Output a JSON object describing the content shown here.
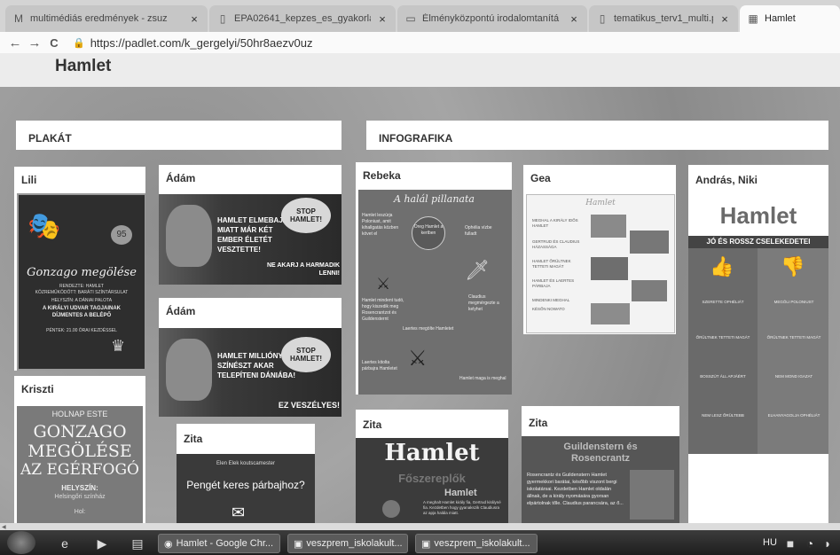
{
  "browser": {
    "tabs": [
      {
        "title": "multimédiás eredmények - zsuz",
        "icon": "gmail-icon",
        "glyph": "M"
      },
      {
        "title": "EPA02641_kepzes_es_gyakorlat",
        "icon": "document-icon",
        "glyph": "▯"
      },
      {
        "title": "Élményközpontú irodalomtanítá",
        "icon": "book-icon",
        "glyph": "▭"
      },
      {
        "title": "tematikus_terv1_multi.pdf",
        "icon": "document-icon",
        "glyph": "▯"
      },
      {
        "title": "Hamlet",
        "icon": "padlet-icon",
        "glyph": "▦"
      }
    ],
    "url": "https://padlet.com/k_gergelyi/50hr8aezv0uz",
    "back": "←",
    "forward": "→",
    "reload": "C",
    "close": "×"
  },
  "padlet": {
    "title": "Hamlet",
    "sections": [
      {
        "title": "PLAKÁT"
      },
      {
        "title": "INFOGRAFIKA"
      }
    ],
    "cards": {
      "lili": {
        "author": "Lili",
        "poster_title": "Gonzago megölése",
        "poster_sub1": "RENDEZTE: HAMLET",
        "poster_sub2": "KÖZREMŰKÖDŐTT: BARÁTI SZÍNTÁRSULAT",
        "poster_sub3": "HELYSZÍN: A DÁNIAI PALOTA",
        "poster_sub4": "A KIRÁLYI UDVAR TAGJAINAK DÍJMENTES A BELÉPŐ",
        "poster_sub5": "PÉNTEK: 21.00 ÓRAI KEZDÉSSEL",
        "mask_text": "95"
      },
      "adam1": {
        "author": "Ádám",
        "text": "HAMLET ELMEBAJA MIATT MÁR KÉT EMBER ÉLETÉT VESZTETTE!",
        "text2": "NE AKARJ A HARMADIK LENNI!",
        "sign": "STOP HAMLET!"
      },
      "adam2": {
        "author": "Ádám",
        "text": "HAMLET MILLIÓNYI SZÍNÉSZT AKAR TELEPÍTENI DÁNIÁBA!",
        "text2": "EZ VESZÉLYES!",
        "sign": "STOP HAMLET!"
      },
      "kriszti": {
        "author": "Kriszti",
        "line1": "HOLNAP ESTE",
        "line2": "GONZAGO",
        "line3": "MEGÖLÉSE",
        "line4": "AZ EGÉRFOGÓ",
        "line5": "HELYSZÍN:",
        "line6": "Helsingőri színház",
        "line7": "Hol:"
      },
      "zita1": {
        "author": "Zita",
        "small": "Elen Elek koutscamester",
        "headline": "Pengét keres párbajhoz?"
      },
      "rebeka": {
        "author": "Rebeka",
        "heading": "A halál pillanata",
        "t1": "Hamlet leszúrja Poloniust, amit kihallgatás közben követ el",
        "t2": "Oreg Hamlet a kertben",
        "t3": "Ophélia vízbe fulladt",
        "t4": "Hamlet mindent tudó, hogy kiszedik meg Rosencrantzot és Guildensternt",
        "t5": "Claudius megmérgezte a kelyhet",
        "t6": "Laertes megölte Hamletet",
        "t7": "Laertes kitolta párbajra Hamletet",
        "t8": "Hamlet maga is meghal"
      },
      "gea": {
        "author": "Gea",
        "heading": "Hamlet",
        "b1": "MEGHAL A KIRÁLY IDŐS HAMLET",
        "b2": "GERTRUD ÉS CLAUDIUS HÁZASSÁGA",
        "b3": "HAMLET ŐRÜLTNEK TETTETI MAGÁT",
        "b4": "HAMLET ÉS LAERTES PÁRBAJA",
        "b5": "MINDENKI MEGHAL",
        "b6": "KÉSŐN NOWATO"
      },
      "andras": {
        "author": "András, Niki",
        "heading": "Hamlet",
        "sub": "JÓ ÉS ROSSZ CSELEKEDETEI",
        "left_labels": [
          "SZERETTE OPHÉLIÁT",
          "ŐRÜLTNEK TETTETI MAGÁT",
          "BOSSZÚT ÁLL APJÁÉRT",
          "NEM LESZ ŐRÜLTEBB"
        ],
        "right_labels": [
          "MEGÖLI POLONIUST",
          "ŐRÜLTNEK TETTETI MAGÁT",
          "NEM MOND IGAZAT",
          "ELHANYAGOLJA OPHÉLIÁT"
        ]
      },
      "zita2": {
        "author": "Zita",
        "headline": "Hamlet",
        "sub": "Főszereplők",
        "name": "Hamlet",
        "body": "A meghalt Hamlet király fia, Gertrud királyné fia. Kezdetben hogy gyanakszik Claudiusra az apja halála miatt."
      },
      "zita3": {
        "author": "Zita",
        "headline1": "Guildenstern és",
        "headline2": "Rosencrantz",
        "body": "Rosencrantz és Guildenstern Hamlet gyermekkori barátai, később viszont bergi iskolatársai. Kezdetben Hamlet oldalán állnak, de a király nyomására gyorsan elpártolnak tőle. Claudius parancsára, az ő..."
      }
    }
  },
  "taskbar": {
    "items": [
      {
        "label": "Hamlet - Google Chr..."
      },
      {
        "label": "veszprem_iskolakult..."
      },
      {
        "label": "veszprem_iskolakult..."
      }
    ],
    "lang": "HU"
  }
}
